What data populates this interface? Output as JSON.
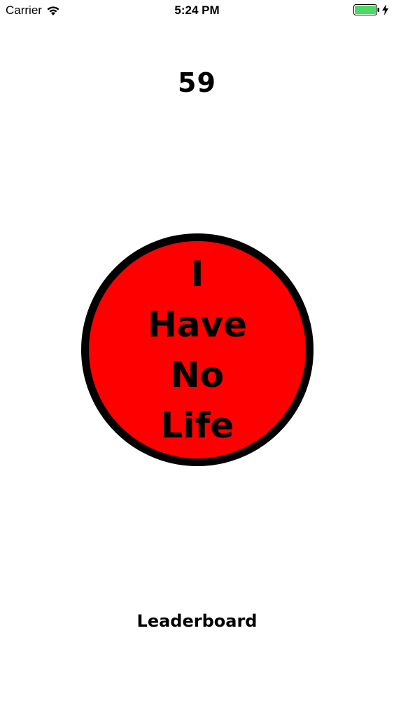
{
  "status_bar": {
    "carrier": "Carrier",
    "time": "5:24 PM",
    "battery_color": "#4cd964",
    "icons": [
      "wifi-icon",
      "battery-icon",
      "charging-bolt-icon"
    ]
  },
  "game": {
    "score": "59",
    "button_lines": [
      "I",
      "Have",
      "No",
      "Life"
    ],
    "button_color": "#ff0000",
    "leaderboard_label": "Leaderboard"
  }
}
